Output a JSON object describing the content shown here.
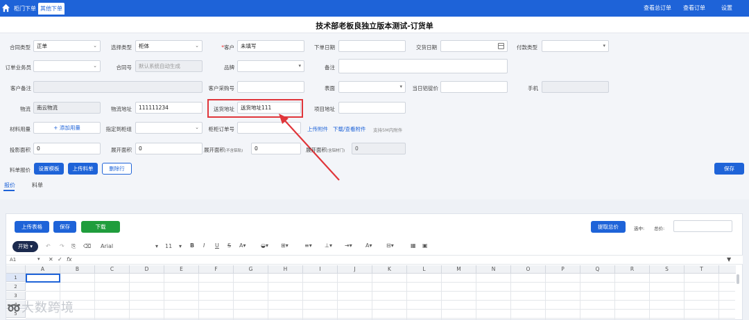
{
  "topbar": {
    "tabs": [
      "柜门下单",
      "其他下单"
    ],
    "nav": [
      "查看总订单",
      "查看订单",
      "设置"
    ]
  },
  "title": "技术部老板良独立版本测试-订货单",
  "form": {
    "contract_type_label": "合同类型",
    "contract_type_value": "正单",
    "select_type_label": "选择类型",
    "select_type_value": "柜体",
    "customer_label": "客户",
    "customer_value": "未填写",
    "order_date_label": "下单日期",
    "delivery_date_label": "交货日期",
    "payment_type_label": "付款类型",
    "salesperson_label": "订单业务员",
    "contract_no_label": "合同号",
    "contract_no_placeholder": "默认系统自动生成",
    "brand_label": "品牌",
    "remark_label": "备注",
    "customer_remark_label": "客户备注",
    "customer_po_label": "客户采购号",
    "color_label": "表面",
    "daily_price_label": "当日铝锭价",
    "phone_label": "手机",
    "logistics_label": "物流",
    "logistics_value": "南云物流",
    "logistics_addr_label": "物流地址",
    "logistics_addr_value": "111111234",
    "delivery_addr_label": "送货地址",
    "delivery_addr_value": "送货地址111",
    "project_addr_label": "项目地址",
    "material_label": "材料用量",
    "add_material": "+ 添加用量",
    "cabinet_label": "指定到柜组",
    "cabinet_order_label": "柜柜订单号",
    "upload_attach": "上传附件",
    "download_attach": "下载/查看附件",
    "attach_hint": "支持5M内附件",
    "projected_area_label": "投影面积",
    "projected_area_value": "0",
    "expand_area_label": "展开面积",
    "expand_area_value": "0",
    "expand_area2_label": "展开面积",
    "expand_area2_suffix": "(不含铝轨)",
    "expand_area2_value": "0",
    "expand_area3_label": "展开面积",
    "expand_area3_suffix": "(含铝材门)",
    "expand_area3_value": "0",
    "quote_label": "料单报价",
    "set_template": "设置模板",
    "upload_list": "上传料单",
    "delete_row": "删除行",
    "save": "保存",
    "tabs": [
      "报价",
      "料单"
    ]
  },
  "sheet": {
    "upload_template": "上传表格",
    "save": "保存",
    "download": "下载",
    "fetch_total": "提取总价",
    "selected_label": "选中:",
    "total_label": "总价:",
    "start": "开始",
    "font": "Arial",
    "font_size": "11",
    "cell_ref": "A1",
    "fx": "fx",
    "columns": [
      "A",
      "B",
      "C",
      "D",
      "E",
      "F",
      "G",
      "H",
      "I",
      "J",
      "K",
      "L",
      "M",
      "N",
      "O",
      "P",
      "Q",
      "R",
      "S",
      "T"
    ],
    "rows": [
      "1",
      "2",
      "3",
      "4",
      "5"
    ]
  },
  "watermark": "大数跨境"
}
